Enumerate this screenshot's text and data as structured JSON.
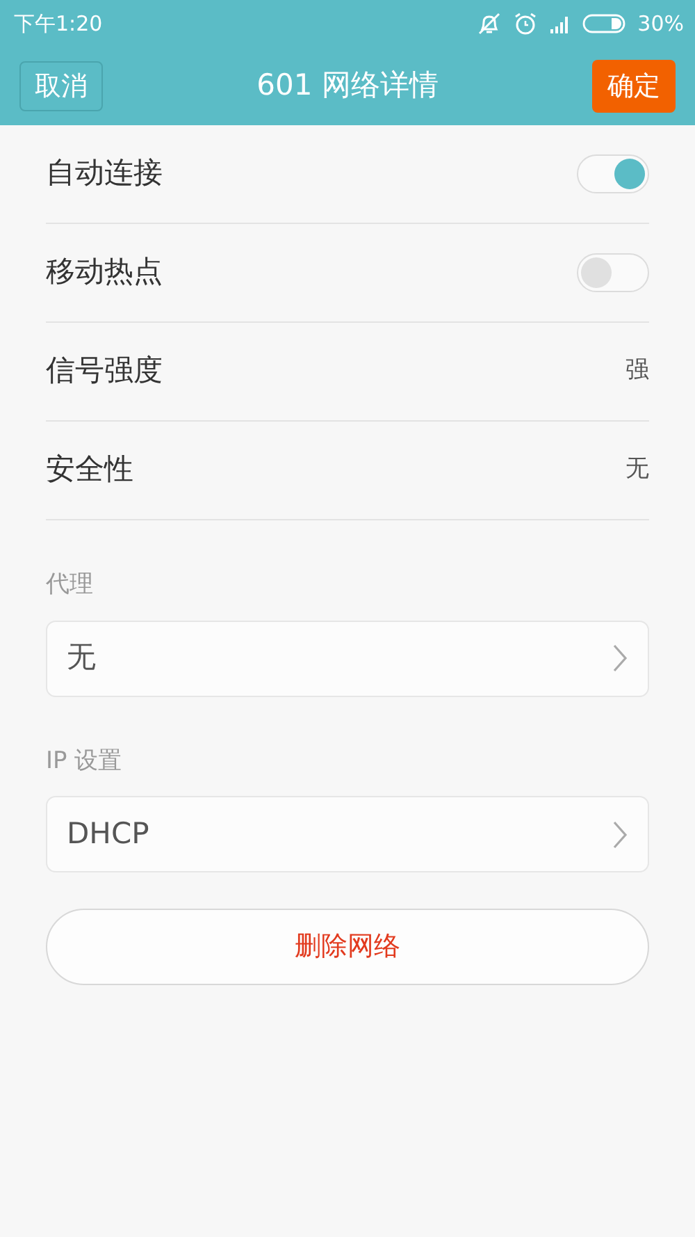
{
  "status_bar": {
    "time": "下午1:20",
    "battery_text": "30%"
  },
  "header": {
    "cancel": "取消",
    "title": "601 网络详情",
    "confirm": "确定"
  },
  "settings": [
    {
      "kind": "toggle",
      "label": "自动连接",
      "on": true
    },
    {
      "kind": "toggle",
      "label": "移动热点",
      "on": false
    },
    {
      "kind": "value",
      "label": "信号强度",
      "value": "强"
    },
    {
      "kind": "value",
      "label": "安全性",
      "value": "无"
    }
  ],
  "sections": [
    {
      "label": "代理",
      "value": "无"
    },
    {
      "label": "IP 设置",
      "value": "DHCP"
    }
  ],
  "delete_button": "删除网络"
}
